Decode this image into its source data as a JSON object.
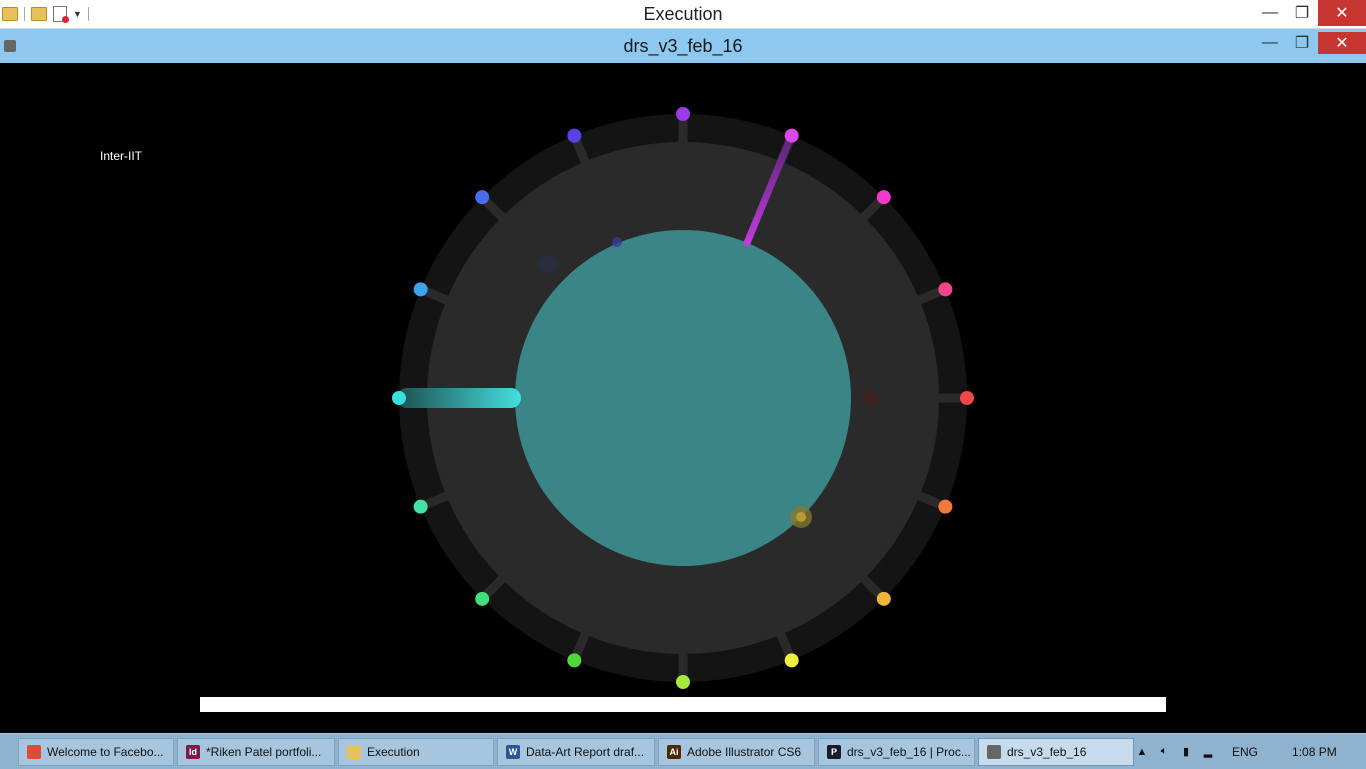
{
  "explorer": {
    "title": "Execution"
  },
  "processing_window": {
    "title": "drs_v3_feb_16"
  },
  "window_controls": {
    "minimize": "—",
    "maximize": "❐",
    "close": "✕"
  },
  "visualization": {
    "label": "Inter-IIT",
    "ring_color": "#2a2a2a",
    "outer_band_color": "#141414",
    "center_color": "#3a8585",
    "nodes": [
      {
        "angle": 0,
        "color": "#f24848"
      },
      {
        "angle": 22.5,
        "color": "#f2458a"
      },
      {
        "angle": 45,
        "color": "#f03ccc"
      },
      {
        "angle": 67.5,
        "color": "#d948e8"
      },
      {
        "angle": 90,
        "color": "#9a3ae8"
      },
      {
        "angle": 112.5,
        "color": "#5a43e6"
      },
      {
        "angle": 135,
        "color": "#4a6cea"
      },
      {
        "angle": 157.5,
        "color": "#3aa2ee"
      },
      {
        "angle": 180,
        "color": "#3ae0e0"
      },
      {
        "angle": 202.5,
        "color": "#43e0a8"
      },
      {
        "angle": 225,
        "color": "#3ee07a"
      },
      {
        "angle": 247.5,
        "color": "#4ed83a"
      },
      {
        "angle": 270,
        "color": "#a8e83a"
      },
      {
        "angle": 292.5,
        "color": "#eef03c"
      },
      {
        "angle": 315,
        "color": "#f0b43a"
      },
      {
        "angle": 337.5,
        "color": "#f07a3a"
      }
    ]
  },
  "progress": {
    "fraction": 1.0
  },
  "taskbar": {
    "items": [
      {
        "label": "Welcome to Facebo...",
        "icon": "chrome-icon",
        "icon_color": "#dd4b39",
        "glyph": ""
      },
      {
        "label": "*Riken Patel portfoli...",
        "icon": "indesign-icon",
        "icon_color": "#7a1a4a",
        "glyph": "Id"
      },
      {
        "label": "Execution",
        "icon": "folder-icon",
        "icon_color": "#e8c15a",
        "glyph": ""
      },
      {
        "label": "Data-Art Report draf...",
        "icon": "word-icon",
        "icon_color": "#2b5797",
        "glyph": "W"
      },
      {
        "label": "Adobe Illustrator CS6",
        "icon": "illustrator-icon",
        "icon_color": "#4a2a00",
        "glyph": "Ai"
      },
      {
        "label": "drs_v3_feb_16 | Proc...",
        "icon": "processing-icon",
        "icon_color": "#1a1a2a",
        "glyph": "P"
      },
      {
        "label": "drs_v3_feb_16",
        "icon": "sketch-window-icon",
        "icon_color": "#666666",
        "glyph": ""
      }
    ],
    "tray": {
      "language": "ENG",
      "time": "1:08 PM"
    }
  }
}
